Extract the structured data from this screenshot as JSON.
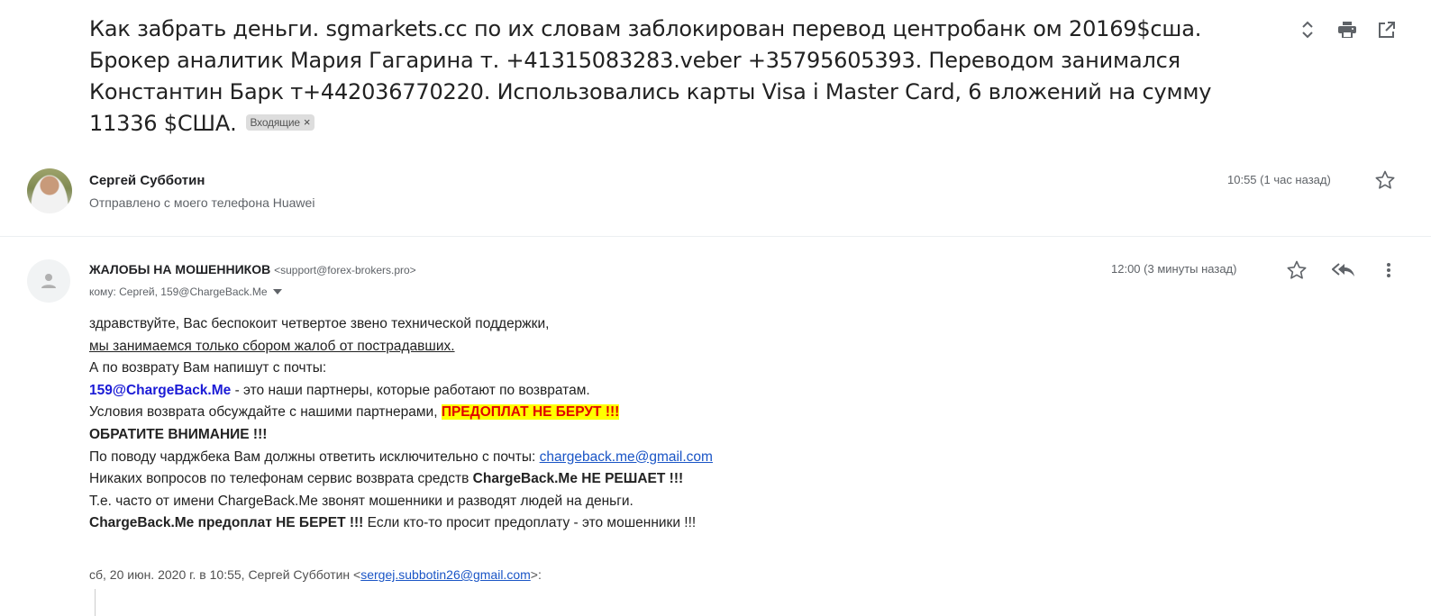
{
  "subject": {
    "text": "Как забрать деньги. sgmarkets.cc по их словам заблокирован перевод центробанк ом 20169$сша. Брокер аналитик Мария Гагарина т. +41315083283.veber +35795605393. Переводом занимался Константин Барк т+442036770220. Использовались карты Visa i Master Card, 6 вложений на сумму 11336 $США.",
    "label": "Входящие",
    "label_remove": "×"
  },
  "toolbar": {
    "icons": [
      "expand-collapse-icon",
      "print-icon",
      "open-new-window-icon"
    ]
  },
  "message1": {
    "sender": "Сергей Субботин",
    "snippet": "Отправлено с моего телефона Huawei",
    "time": "10:55 (1 час назад)"
  },
  "message2": {
    "sender_name": "ЖАЛОБЫ НА МОШЕННИКОВ",
    "sender_email": "<support@forex-brokers.pro>",
    "to": "кому: Сергей, 159@ChargeBack.Me",
    "time": "12:00 (3 минуты назад)",
    "body": {
      "l1": "здравствуйте, Вас беспокоит четвертое звено технической поддержки,",
      "l2": "мы занимаемся только сбором жалоб от пострадавших.",
      "l3": "А по возврату Вам напишут с почты:",
      "l4_bold": "159@ChargeBack.Me",
      "l4_rest": " - это наши партнеры, которые работают по возвратам.",
      "l5_text": "Условия возврата обсуждайте с нашими партнерами, ",
      "l5_highlight": "ПРЕДОПЛАТ НЕ БЕРУТ !!!",
      "l6": "ОБРАТИТЕ ВНИМАНИЕ !!!",
      "l7_text": "По поводу чарджбека Вам должны ответить исключительно с почты: ",
      "l7_link": "chargeback.me@gmail.com",
      "l8_text": "Никаких вопросов по телефонам сервис возврата средств ",
      "l8_bold": "ChargeBack.Me НЕ РЕШАЕТ !!!",
      "l9": "Т.е. часто от имени ChargeBack.Me звонят мошенники и разводят людей на деньги.",
      "l10_bold": "ChargeBack.Me предоплат НЕ БЕРЕТ !!!",
      "l10_rest": " Если кто-то просит предоплату - это мошенники !!!"
    },
    "quote": {
      "prefix": "сб, 20 июн. 2020 г. в 10:55, Сергей Субботин <",
      "email": "sergej.subbotin26@gmail.com",
      "suffix": ">:"
    }
  },
  "colors": {
    "highlight_bg": "#ffff00",
    "highlight_text": "#e00000",
    "link": "#1a55c6",
    "partner_email": "#1b1bd6"
  }
}
